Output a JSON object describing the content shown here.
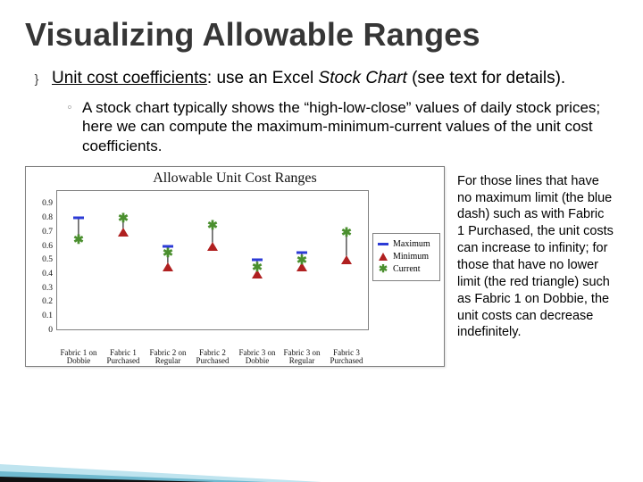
{
  "title": "Visualizing Allowable Ranges",
  "bullet": {
    "underlined": "Unit cost coefficients",
    "rest_before_italic": ": use an Excel ",
    "italic": "Stock Chart",
    "rest_after_italic": " (see text for details)."
  },
  "subbullet": "A stock chart typically shows the “high-low-close” values of daily stock prices; here we can compute the maximum-minimum-current values of the unit cost coefficients.",
  "side_note": "For those lines that have no maximum limit (the blue dash) such as with Fabric 1 Purchased, the unit costs can increase to infinity; for those that have no lower limit (the red triangle) such as Fabric 1 on Dobbie, the unit costs can decrease indefinitely.",
  "chart_data": {
    "type": "stock-hlc",
    "title": "Allowable Unit Cost Ranges",
    "ylabel": "",
    "xlabel": "",
    "ylim": [
      0,
      1
    ],
    "yticks": [
      0,
      0.1,
      0.2,
      0.3,
      0.4,
      0.5,
      0.6,
      0.7,
      0.8,
      0.9
    ],
    "categories": [
      "Fabric 1 on Dobbie",
      "Fabric 1 Purchased",
      "Fabric 2 on Regular",
      "Fabric 2 Purchased",
      "Fabric 3 on Dobbie",
      "Fabric 3 on Regular",
      "Fabric 3 Purchased"
    ],
    "series": [
      {
        "name": "Maximum",
        "values": [
          0.8,
          null,
          0.6,
          null,
          0.5,
          0.55,
          null
        ]
      },
      {
        "name": "Minimum",
        "values": [
          null,
          0.7,
          0.45,
          0.6,
          0.4,
          0.45,
          0.5
        ]
      },
      {
        "name": "Current",
        "values": [
          0.65,
          0.8,
          0.55,
          0.75,
          0.45,
          0.5,
          0.7
        ]
      }
    ],
    "legend": [
      "Maximum",
      "Minimum",
      "Current"
    ]
  }
}
